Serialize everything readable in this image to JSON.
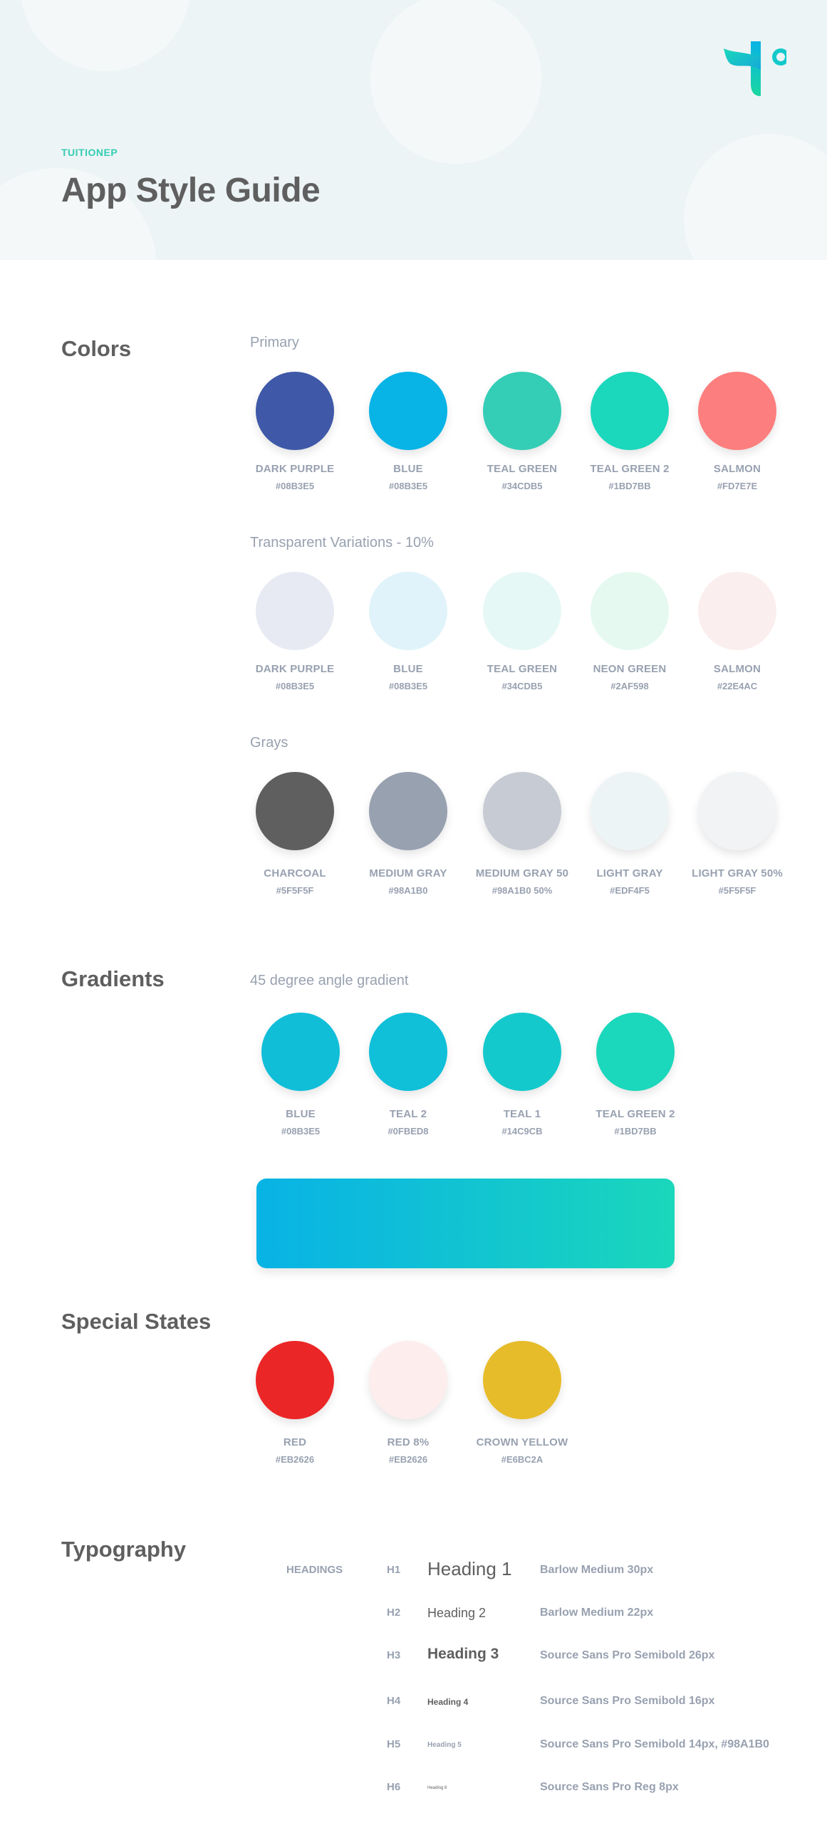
{
  "header": {
    "brand": "TUITIONEP",
    "title": "App Style Guide",
    "logo_icon": "tuitionep-logo-icon"
  },
  "colors": {
    "section_title": "Colors",
    "primary": {
      "label": "Primary",
      "swatches": [
        {
          "name": "DARK PURPLE",
          "hex": "#08B3E5",
          "fill": "#3F59A8"
        },
        {
          "name": "BLUE",
          "hex": "#08B3E5",
          "fill": "#08B3E5"
        },
        {
          "name": "TEAL GREEN",
          "hex": "#34CDB5",
          "fill": "#34CDB5"
        },
        {
          "name": "TEAL GREEN 2",
          "hex": "#1BD7BB",
          "fill": "#1BD7BB"
        },
        {
          "name": "SALMON",
          "hex": "#FD7E7E",
          "fill": "#FD7E7E"
        }
      ]
    },
    "transparent": {
      "label": "Transparent Variations - 10%",
      "swatches": [
        {
          "name": "DARK PURPLE",
          "hex": "#08B3E5",
          "fill": "#E8EAF3"
        },
        {
          "name": "BLUE",
          "hex": "#08B3E5",
          "fill": "#E0F3FA"
        },
        {
          "name": "TEAL GREEN",
          "hex": "#34CDB5",
          "fill": "#E6F8F5"
        },
        {
          "name": "NEON GREEN",
          "hex": "#2AF598",
          "fill": "#E5F9F0"
        },
        {
          "name": "SALMON",
          "hex": "#22E4AC",
          "fill": "#FBEEEE"
        }
      ]
    },
    "grays": {
      "label": "Grays",
      "swatches": [
        {
          "name": "CHARCOAL",
          "hex": "#5F5F5F",
          "fill": "#5F5F5F"
        },
        {
          "name": "MEDIUM GRAY",
          "hex": "#98A1B0",
          "fill": "#98A1B0"
        },
        {
          "name": "MEDIUM GRAY 50",
          "hex": "#98A1B0 50%",
          "fill": "#C7CBD3"
        },
        {
          "name": "LIGHT GRAY",
          "hex": "#EDF4F5",
          "fill": "#EDF4F5"
        },
        {
          "name": "LIGHT GRAY 50%",
          "hex": "#5F5F5F",
          "fill": "#F2F3F4"
        }
      ]
    }
  },
  "gradients": {
    "section_title": "Gradients",
    "label": "45 degree angle gradient",
    "swatches": [
      {
        "name": "BLUE",
        "hex": "#08B3E5",
        "fill": "#10BED8"
      },
      {
        "name": "TEAL 2",
        "hex": "#0FBED8",
        "fill": "#10BFD8"
      },
      {
        "name": "TEAL 1",
        "hex": "#14C9CB",
        "fill": "#14C9CB"
      },
      {
        "name": "TEAL GREEN 2",
        "hex": "#1BD7BB",
        "fill": "#1BD7BB"
      }
    ]
  },
  "special_states": {
    "section_title": "Special States",
    "swatches": [
      {
        "name": "RED",
        "hex": "#EB2626",
        "fill": "#EB2626"
      },
      {
        "name": "RED 8%",
        "hex": "#EB2626",
        "fill": "#FDEDED"
      },
      {
        "name": "CROWN YELLOW",
        "hex": "#E6BC2A",
        "fill": "#E6BC2A"
      }
    ]
  },
  "typography": {
    "section_title": "Typography",
    "category": "HEADINGS",
    "rows": [
      {
        "tag": "H1",
        "sample": "Heading 1",
        "spec": "Barlow Medium 30px"
      },
      {
        "tag": "H2",
        "sample": "Heading 2",
        "spec": "Barlow Medium 22px"
      },
      {
        "tag": "H3",
        "sample": "Heading 3",
        "spec": "Source Sans Pro Semibold 26px"
      },
      {
        "tag": "H4",
        "sample": "Heading 4",
        "spec": "Source Sans Pro Semibold 16px"
      },
      {
        "tag": "H5",
        "sample": "Heading 5",
        "spec": "Source Sans Pro Semibold 14px, #98A1B0"
      },
      {
        "tag": "H6",
        "sample": "Heading 6",
        "spec": "Source Sans Pro Reg 8px"
      }
    ]
  }
}
